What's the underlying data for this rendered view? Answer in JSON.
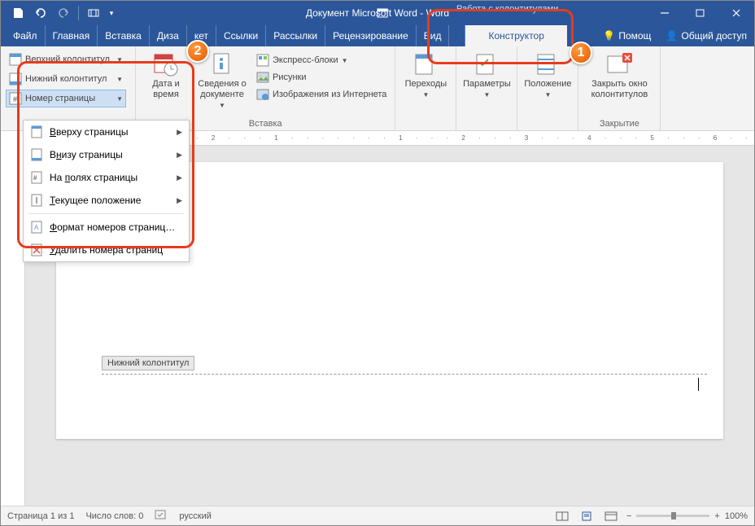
{
  "title": "Документ Microsoft Word - Word",
  "contextual_label": "Работа с колонтитулами",
  "tabs": {
    "file": "Файл",
    "home": "Главная",
    "insert": "Вставка",
    "design": "Диза",
    "layout": "кет",
    "refs": "Ссылки",
    "mail": "Рассылки",
    "review": "Рецензирование",
    "view": "Вид",
    "designer": "Конструктор",
    "help": "Помощ",
    "share": "Общий доступ"
  },
  "ribbon": {
    "hf": {
      "top": "Верхний колонтитул",
      "bottom": "Нижний колонтитул",
      "num": "Номер страницы"
    },
    "datetime": {
      "label": "Дата и время"
    },
    "docinfo": {
      "label": "Сведения о документе"
    },
    "insert_group_label": "Вставка",
    "insert_items": {
      "quick": "Экспресс-блоки",
      "pics": "Рисунки",
      "webpics": "Изображения из Интернета"
    },
    "nav_label": "Переходы",
    "params_label": "Параметры",
    "pos_label": "Положение",
    "close_label": "Закрыть окно колонтитулов",
    "close_group": "Закрытие"
  },
  "menu": {
    "top": "Вверху страницы",
    "bottom": "Внизу страницы",
    "margins": "На полях страницы",
    "current": "Текущее положение",
    "format": "Формат номеров страниц…",
    "remove": "Удалить номера страниц"
  },
  "footer_tag": "Нижний колонтитул",
  "status": {
    "page": "Страница 1 из 1",
    "words": "Число слов: 0",
    "lang": "русский",
    "zoom": "100%"
  },
  "callouts": {
    "one": "1",
    "two": "2"
  }
}
